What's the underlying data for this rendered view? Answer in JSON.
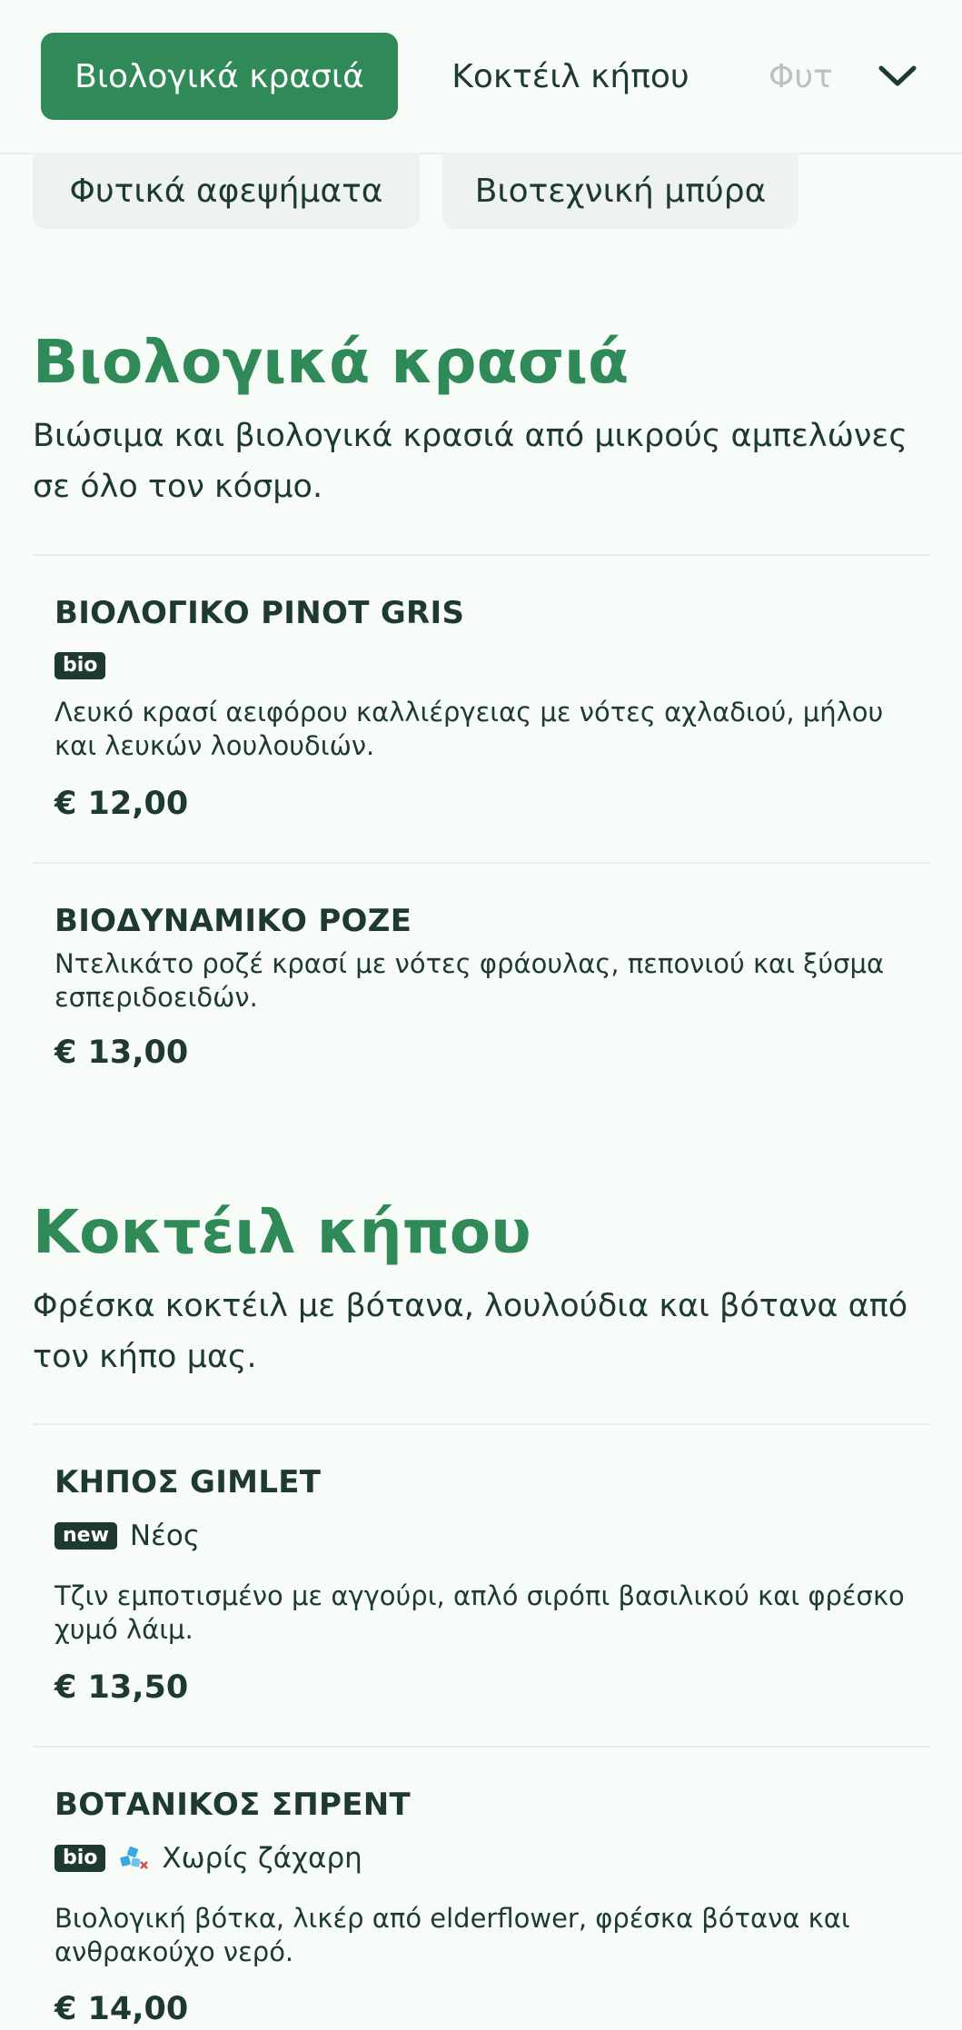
{
  "nav": {
    "tabs": [
      {
        "label": "Βιολογικά κρασιά",
        "active": true
      },
      {
        "label": "Κοκτέιλ κήπου",
        "active": false
      },
      {
        "label": "Φυτ",
        "active": false
      }
    ],
    "expand_icon": "chevron-down-icon",
    "chips": [
      {
        "label": "Φυτικά αφεψήματα"
      },
      {
        "label": "Βιοτεχνική μπύρα"
      }
    ]
  },
  "colors": {
    "accent": "#2f8a57",
    "text": "#1e3a30",
    "background": "#f7fcf9",
    "chip_bg": "#eef3f1"
  },
  "sections": [
    {
      "title": "Βιολογικά κρασιά",
      "description": "Βιώσιμα και βιολογικά κρασιά από μικρούς αμπελώνες σε όλο τον κόσμο.",
      "items": [
        {
          "name": "ΒΙΟΛΟΓΙΚΟ PINOT GRIS",
          "badge": "bio",
          "description": "Λευκό κρασί αειφόρου καλλιέργειας με νότες αχλαδιού, μήλου και λευκών λουλουδιών.",
          "price": "€ 12,00"
        },
        {
          "name": "ΒΙΟΔΥΝΑΜΙΚΟ ΡΟΖΕ",
          "description": "Ντελικάτο ροζέ κρασί με νότες φράουλας, πεπονιού και ξύσμα εσπεριδοειδών.",
          "price": "€ 13,00"
        }
      ]
    },
    {
      "title": "Κοκτέιλ κήπου",
      "description": "Φρέσκα κοκτέιλ με βότανα, λουλούδια και βότανα από τον κήπο μας.",
      "items": [
        {
          "name": "ΚΗΠΟΣ GIMLET",
          "badge": "new",
          "badge_text": "Νέος",
          "description": "Τζιν εμποτισμένο με αγγούρι, απλό σιρόπι βασιλικού και φρέσκο χυμό λάιμ.",
          "price": "€ 13,50"
        },
        {
          "name": "ΒΟΤΑΝΙΚΟΣ ΣΠΡΕΝΤ",
          "badge": "bio",
          "icon": "sugar-free-icon",
          "badge_text": "Χωρίς ζάχαρη",
          "description": "Βιολογική βότκα, λικέρ από elderflower, φρέσκα βότανα και ανθρακούχο νερό.",
          "price": "€ 14,00"
        }
      ]
    }
  ]
}
